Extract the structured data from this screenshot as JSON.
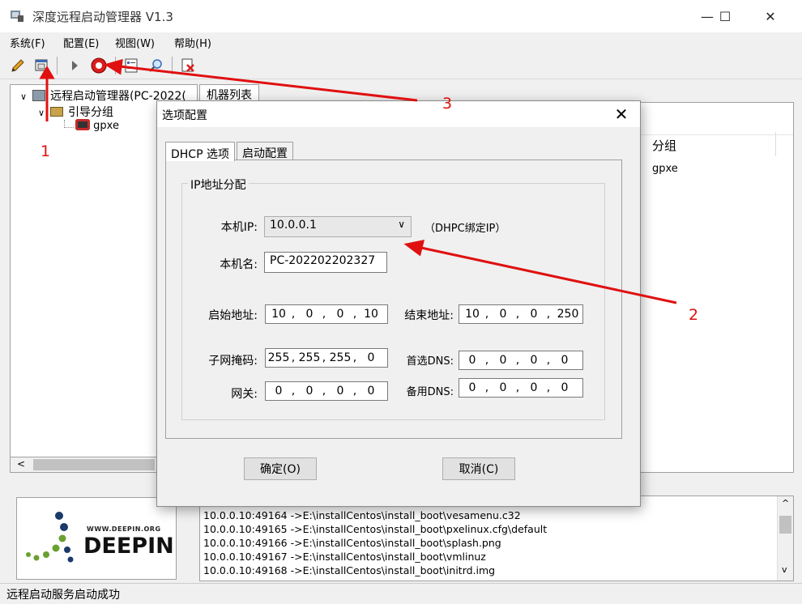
{
  "window": {
    "title": "深度远程启动管理器 V1.3",
    "minimize_glyph": "—",
    "maximize_glyph": "☐",
    "close_glyph": "✕"
  },
  "menu": [
    "系统(F)",
    "配置(E)",
    "视图(W)",
    "帮助(H)"
  ],
  "toolbar": {
    "icons": [
      "pencil-icon",
      "window-icon",
      "play-icon",
      "stop-icon",
      "properties-icon",
      "search-icon",
      "delete-icon"
    ]
  },
  "tree": {
    "root": "远程启动管理器(PC-2022(",
    "group": "引导分组",
    "item": "gpxe"
  },
  "machine_list": {
    "tab": "机器列表",
    "column_header": "分组",
    "row_value": "gpxe"
  },
  "dialog": {
    "title": "选项配置",
    "close_glyph": "✕",
    "tabs": [
      "DHCP 选项",
      "启动配置"
    ],
    "group_title": "IP地址分配",
    "host_ip_label": "本机IP:",
    "host_ip_value": "10.0.0.1",
    "host_ip_note": "（DHPC绑定IP）",
    "host_name_label": "本机名:",
    "host_name_value": "PC-202202202327",
    "start_label": "启始地址:",
    "start_octets": [
      "10",
      "0",
      "0",
      "10"
    ],
    "end_label": "结束地址:",
    "end_octets": [
      "10",
      "0",
      "0",
      "250"
    ],
    "mask_label": "子网掩码:",
    "mask_octets": [
      "255",
      "255",
      "255",
      "0"
    ],
    "dns1_label": "首选DNS:",
    "dns1_octets": [
      "0",
      "0",
      "0",
      "0"
    ],
    "gateway_label": "网关:",
    "gateway_octets": [
      "0",
      "0",
      "0",
      "0"
    ],
    "dns2_label": "备用DNS:",
    "dns2_octets": [
      "0",
      "0",
      "0",
      "0"
    ],
    "ok_label": "确定(O)",
    "cancel_label": "取消(C)"
  },
  "logo": {
    "url_text": "WWW.DEEPIN.ORG",
    "brand_text": "DEEPIN"
  },
  "log_lines": [
    "10.0.0.10:49164 ->E:\\installCentos\\install_boot\\vesamenu.c32",
    "10.0.0.10:49165 ->E:\\installCentos\\install_boot\\pxelinux.cfg\\default",
    "10.0.0.10:49166 ->E:\\installCentos\\install_boot\\splash.png",
    "10.0.0.10:49167 ->E:\\installCentos\\install_boot\\vmlinuz",
    "10.0.0.10:49168 ->E:\\installCentos\\install_boot\\initrd.img"
  ],
  "status_text": "远程启动服务启动成功",
  "annotations": {
    "label_1": "1",
    "label_2": "2",
    "label_3": "3",
    "color": "#e01010"
  }
}
